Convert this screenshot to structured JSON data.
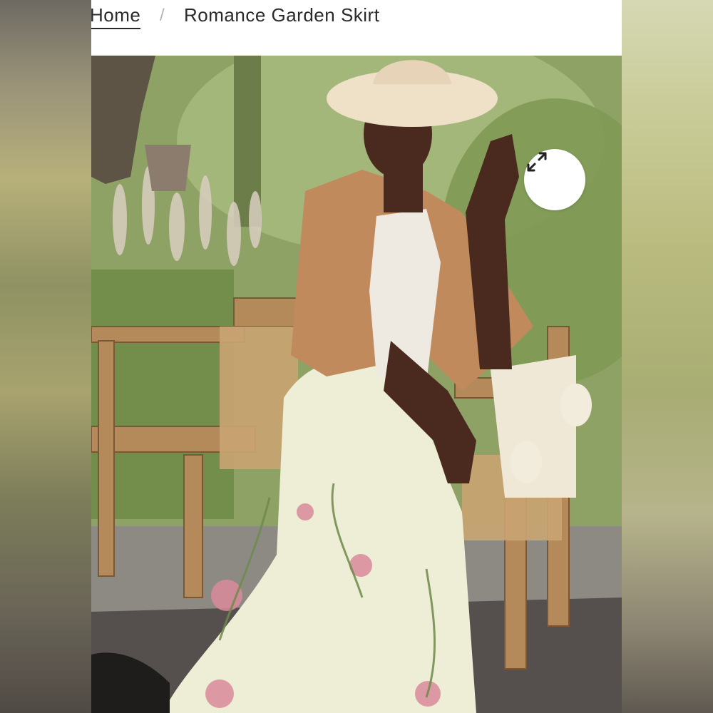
{
  "breadcrumb": {
    "home_label": "Home",
    "separator": "/",
    "current_label": "Romance Garden Skirt"
  },
  "product_image": {
    "alt": "Romance Garden Skirt"
  },
  "expand_button": {
    "icon": "expand-arrows-icon"
  },
  "colors": {
    "text": "#2a2a2a",
    "separator": "#b5b5b5",
    "button_bg": "#ffffff"
  }
}
